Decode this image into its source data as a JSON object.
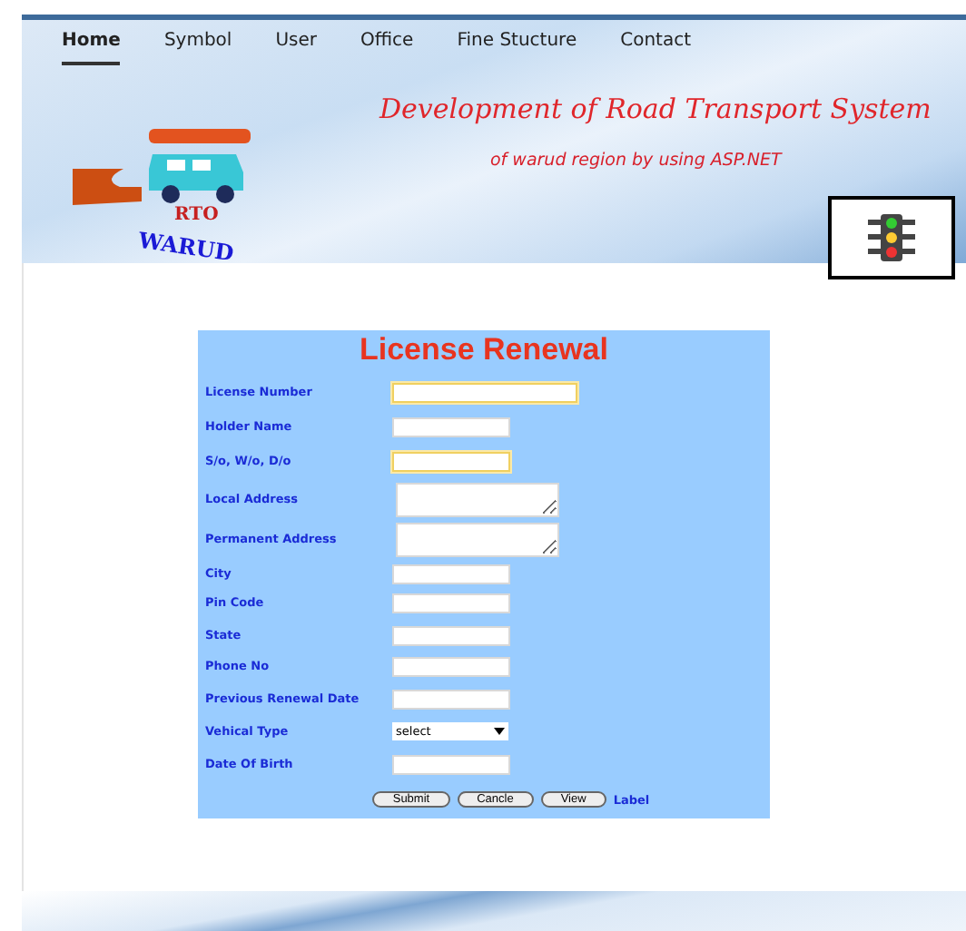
{
  "nav": [
    {
      "label": "Home",
      "selected": true
    },
    {
      "label": "Symbol",
      "selected": false
    },
    {
      "label": "User",
      "selected": false
    },
    {
      "label": "Office",
      "selected": false
    },
    {
      "label": "Fine Stucture",
      "selected": false
    },
    {
      "label": "Contact",
      "selected": false
    }
  ],
  "header": {
    "title": "Development of Road Transport System",
    "subtitle": "of warud region by using ASP.NET",
    "logo_top": "RTO",
    "logo_bottom": "WARUD"
  },
  "form": {
    "title": "License Renewal",
    "fields": [
      {
        "label": "License Number",
        "kind": "long",
        "highlighted": true
      },
      {
        "label": "Holder Name",
        "kind": "text",
        "highlighted": false
      },
      {
        "label": "S/o, W/o, D/o",
        "kind": "text",
        "highlighted": true
      },
      {
        "label": "Local Address",
        "kind": "textarea",
        "highlighted": false
      },
      {
        "label": "Permanent Address",
        "kind": "textarea",
        "highlighted": false
      },
      {
        "label": "City",
        "kind": "text",
        "highlighted": false
      },
      {
        "label": "Pin Code",
        "kind": "text",
        "highlighted": false
      },
      {
        "label": "State",
        "kind": "text",
        "highlighted": false
      },
      {
        "label": "Phone No",
        "kind": "text",
        "highlighted": false
      },
      {
        "label": "Previous Renewal Date",
        "kind": "text",
        "highlighted": false
      },
      {
        "label": "Vehical Type",
        "kind": "select",
        "value": "select",
        "highlighted": false
      },
      {
        "label": "Date Of Birth",
        "kind": "text",
        "highlighted": false
      }
    ],
    "buttons": [
      "Submit",
      "Cancle",
      "View"
    ],
    "label": "Label"
  }
}
